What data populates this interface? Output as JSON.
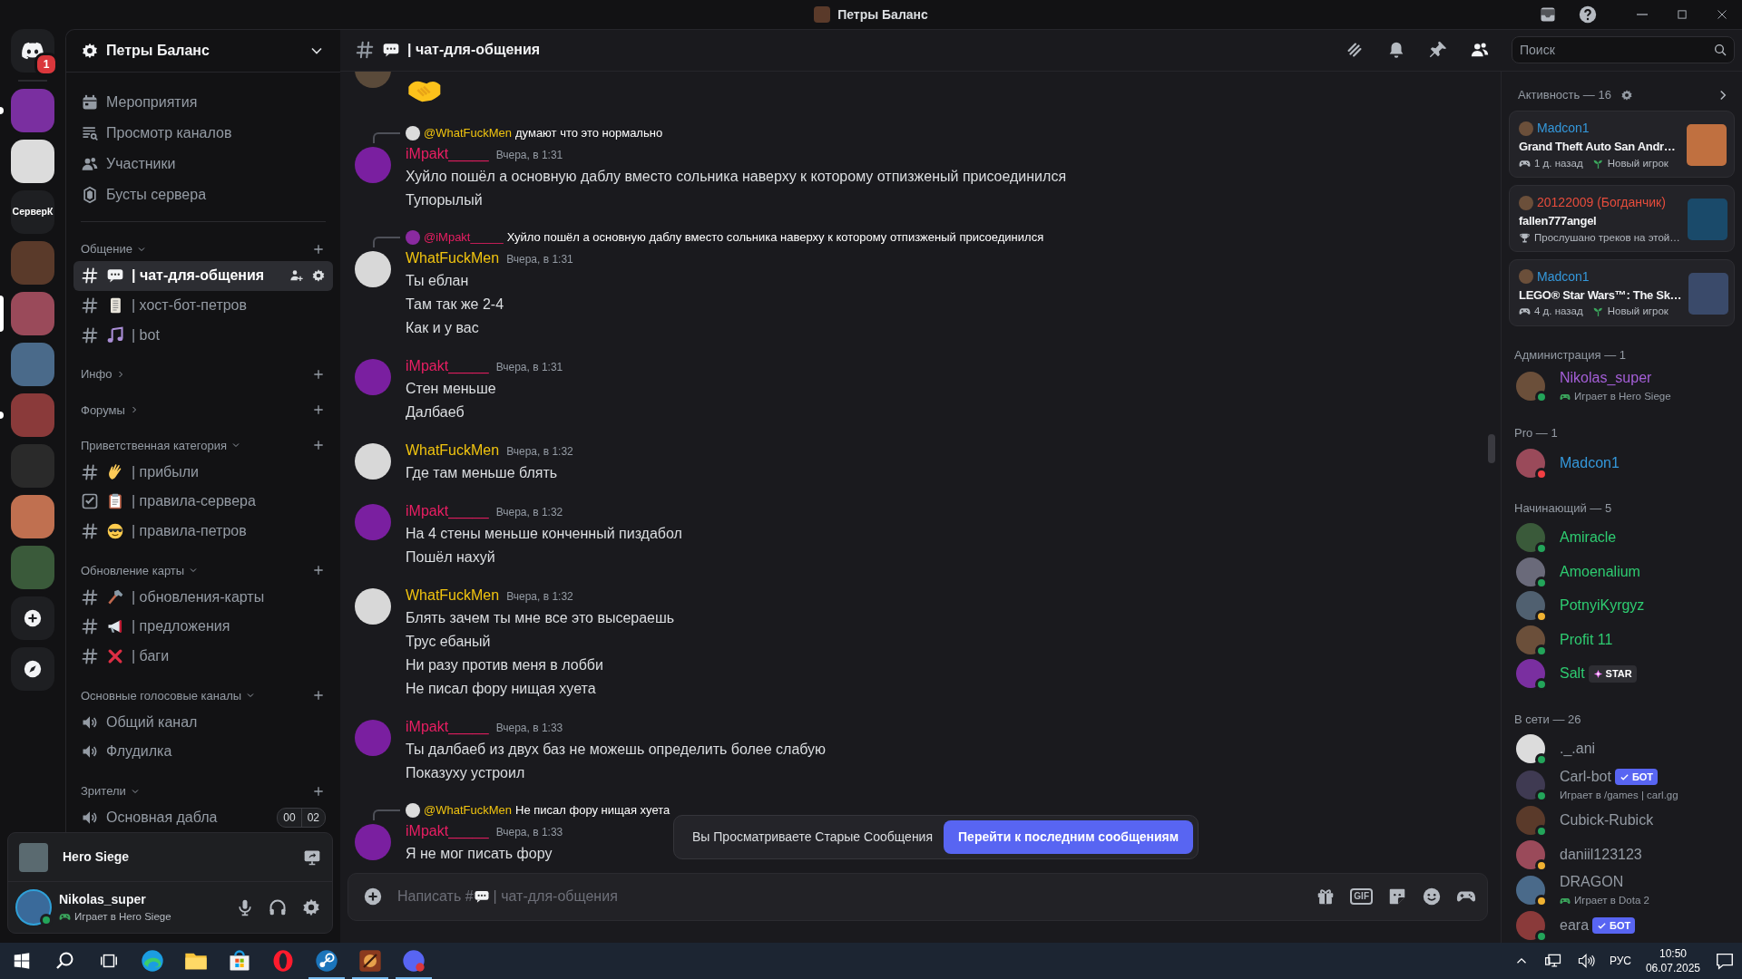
{
  "title_bar": {
    "title": "Петры Баланс"
  },
  "servers": [
    {
      "kind": "home",
      "badge": "1",
      "selected": false,
      "unread": false
    },
    {
      "kind": "image",
      "selected": false,
      "unread": true
    },
    {
      "kind": "image",
      "selected": false,
      "unread": false
    },
    {
      "kind": "text",
      "label": "СерверК",
      "selected": false,
      "unread": false
    },
    {
      "kind": "image",
      "selected": false,
      "unread": false
    },
    {
      "kind": "image",
      "selected": true,
      "unread": false
    },
    {
      "kind": "image",
      "selected": false,
      "unread": false
    },
    {
      "kind": "image",
      "selected": false,
      "unread": true
    },
    {
      "kind": "image",
      "selected": false,
      "unread": false
    },
    {
      "kind": "image",
      "selected": false,
      "unread": false
    },
    {
      "kind": "image",
      "selected": false,
      "unread": false
    },
    {
      "kind": "add",
      "selected": false,
      "unread": false
    },
    {
      "kind": "discover",
      "selected": false,
      "unread": false
    }
  ],
  "guild": {
    "name": "Петры Баланс"
  },
  "shortcuts": [
    {
      "label": "Мероприятия"
    },
    {
      "label": "Просмотр каналов"
    },
    {
      "label": "Участники"
    },
    {
      "label": "Бусты сервера"
    }
  ],
  "categories": [
    {
      "name": "Общение",
      "expanded": true,
      "channels": [
        {
          "kind": "text",
          "name": "| чат-для-общения",
          "selected": true
        },
        {
          "kind": "text",
          "name": "| хост-бот-петров",
          "selected": false
        },
        {
          "kind": "text",
          "name": "| bot",
          "selected": false
        }
      ]
    },
    {
      "name": "Инфо",
      "expanded": false
    },
    {
      "name": "Форумы",
      "expanded": false
    },
    {
      "name": "Приветственная категория",
      "expanded": true,
      "channels": [
        {
          "kind": "text",
          "name": "| прибыли",
          "selected": false
        },
        {
          "kind": "rules",
          "name": "| правила-сервера",
          "selected": false
        },
        {
          "kind": "text",
          "name": "| правила-петров",
          "selected": false
        }
      ]
    },
    {
      "name": "Обновление карты",
      "expanded": true,
      "channels": [
        {
          "kind": "text",
          "name": "| обновления-карты",
          "selected": false
        },
        {
          "kind": "text",
          "name": "| предложения",
          "selected": false
        },
        {
          "kind": "text",
          "name": "| баги",
          "selected": false
        }
      ]
    },
    {
      "name": "Основные голосовые каналы",
      "expanded": true,
      "channels": [
        {
          "kind": "voice",
          "name": "Общий канал",
          "selected": false
        },
        {
          "kind": "voice",
          "name": "Флудилка",
          "selected": false
        }
      ]
    },
    {
      "name": "Зрители",
      "expanded": true,
      "channels": [
        {
          "kind": "voice",
          "name": "Основная дабла",
          "selected": false,
          "counts": [
            "00",
            "02"
          ]
        }
      ]
    }
  ],
  "user_panel": {
    "game": "Hero Siege",
    "name": "Nikolas_super",
    "status": {
      "color": "#23a55a"
    },
    "activity": "Играет в Hero Siege"
  },
  "header": {
    "channel": "| чат-для-общения",
    "search_placeholder": "Поиск"
  },
  "messages": [
    {
      "kind": "cut"
    },
    {
      "kind": "message",
      "author": "iMpakt_____",
      "color": "#e91e63",
      "time": "Вчера, в 1:31",
      "reply": {
        "mention": "@WhatFuckMen",
        "color": "#f1c40f",
        "text": "думают что это нормально"
      },
      "lines": [
        "Хуйло пошёл а основную даблу вместо сольника наверху к которому отпизженый присоединился",
        "Тупорылый"
      ]
    },
    {
      "kind": "message",
      "author": "WhatFuckMen",
      "color": "#f1c40f",
      "time": "Вчера, в 1:31",
      "reply": {
        "mention": "@iMpakt_____",
        "color": "#e91e63",
        "text": "Хуйло пошёл а основную даблу вместо сольника наверху к которому отпизженый присоединился"
      },
      "lines": [
        "Ты еблан",
        "Там так же 2-4",
        "Как и у вас"
      ]
    },
    {
      "kind": "message",
      "author": "iMpakt_____",
      "color": "#e91e63",
      "time": "Вчера, в 1:31",
      "lines": [
        "Стен меньше",
        "Далбаеб"
      ]
    },
    {
      "kind": "message",
      "author": "WhatFuckMen",
      "color": "#f1c40f",
      "time": "Вчера, в 1:32",
      "lines": [
        "Где там меньше блять"
      ]
    },
    {
      "kind": "message",
      "author": "iMpakt_____",
      "color": "#e91e63",
      "time": "Вчера, в 1:32",
      "lines": [
        "На 4 стены меньше конченный пиздабол",
        "Пошёл нахуй"
      ]
    },
    {
      "kind": "message",
      "author": "WhatFuckMen",
      "color": "#f1c40f",
      "time": "Вчера, в 1:32",
      "lines": [
        "Блять зачем ты мне все это высераешь",
        "Трус ебаный",
        "Ни разу против меня в лобби",
        "Не писал фору нищая хуета"
      ]
    },
    {
      "kind": "message",
      "author": "iMpakt_____",
      "color": "#e91e63",
      "time": "Вчера, в 1:33",
      "lines": [
        "Ты далбаеб из двух баз не можешь определить более слабую",
        "Показуху устроил"
      ]
    },
    {
      "kind": "message",
      "author": "iMpakt_____",
      "color": "#e91e63",
      "time": "Вчера, в 1:33",
      "reply": {
        "mention": "@WhatFuckMen",
        "color": "#f1c40f",
        "text": "Не писал фору нищая хуета"
      },
      "lines": [
        "Я не мог писать фору"
      ]
    }
  ],
  "jump_bar": {
    "text": "Вы Просматриваете Старые Сообщения",
    "button": "Перейти к последним сообщениям"
  },
  "composer": {
    "placeholder_start": "Написать #",
    "placeholder_end": "| чат-для-общения",
    "gif": "GIF"
  },
  "activity": {
    "title": "Активность — 16",
    "cards": [
      {
        "user": "Madcon1",
        "color": "#3498db",
        "title": "Grand Theft Auto San Andr…",
        "meta": [
          {
            "kind": "time",
            "text": "1 д. назад"
          },
          {
            "kind": "new",
            "text": "Новый игрок"
          }
        ]
      },
      {
        "user": "20122009 (Богданчик)",
        "color": "#e74c3c",
        "title": "fallen777angel",
        "meta": [
          {
            "kind": "trophy",
            "text": "Прослушано треков на этой…"
          }
        ]
      },
      {
        "user": "Madcon1",
        "color": "#3498db",
        "title": "LEGO® Star Wars™: The Sk…",
        "meta": [
          {
            "kind": "time",
            "text": "4 д. назад"
          },
          {
            "kind": "new",
            "text": "Новый игрок"
          }
        ]
      }
    ]
  },
  "member_groups": [
    {
      "title": "Администрация — 1",
      "members": [
        {
          "name": "Nikolas_super",
          "color": "#a55fd8",
          "status": {
            "color": "#23a55a"
          },
          "sub": {
            "kind": "game",
            "text": "Играет в Hero Siege"
          }
        }
      ]
    },
    {
      "title": "Pro — 1",
      "members": [
        {
          "name": "Madcon1",
          "color": "#3498db",
          "status": {
            "color": "#f23f43"
          }
        }
      ]
    },
    {
      "title": "Начинающий — 5",
      "members": [
        {
          "name": "Amiracle",
          "color": "#2ecc71",
          "status": {
            "color": "#23a55a"
          }
        },
        {
          "name": "Amoenalium",
          "color": "#2ecc71",
          "status": {
            "color": "#23a55a"
          }
        },
        {
          "name": "PotnyiKyrgyz",
          "color": "#2ecc71",
          "status": {
            "color": "#f0b232"
          }
        },
        {
          "name": "Profit 11",
          "color": "#2ecc71",
          "status": {
            "color": "#23a55a"
          }
        },
        {
          "name": "Salt",
          "color": "#2ecc71",
          "status": {
            "color": "#23a55a"
          },
          "tag": {
            "kind": "star",
            "text": "STAR"
          }
        }
      ]
    },
    {
      "title": "В сети — 26",
      "members": [
        {
          "name": "._.ani",
          "color": "#949ba4",
          "status": {
            "color": "#23a55a"
          }
        },
        {
          "name": "Carl-bot",
          "color": "#949ba4",
          "status": {
            "color": "#23a55a"
          },
          "tag": {
            "kind": "bot",
            "text": "БОТ"
          },
          "sub": {
            "kind": "custom",
            "text": "Играет в /games | carl.gg"
          }
        },
        {
          "name": "Cubick-Rubick",
          "color": "#949ba4",
          "status": {
            "color": "#23a55a"
          }
        },
        {
          "name": "daniil123123",
          "color": "#949ba4",
          "status": {
            "color": "#f0b232"
          }
        },
        {
          "name": "DRAGON",
          "color": "#949ba4",
          "status": {
            "color": "#f0b232"
          },
          "sub": {
            "kind": "game",
            "text": "Играет в Dota 2"
          }
        },
        {
          "name": "eara",
          "color": "#949ba4",
          "status": {
            "color": "#23a55a"
          },
          "tag": {
            "kind": "bot",
            "text": "БОТ"
          }
        }
      ]
    }
  ],
  "taskbar": {
    "apps": [
      {
        "running": false
      },
      {
        "running": false
      },
      {
        "running": false
      },
      {
        "running": false
      },
      {
        "running": true
      },
      {
        "running": true
      },
      {
        "running": true
      }
    ],
    "language": "РУС",
    "time": "10:50",
    "date": "06.07.2025"
  }
}
